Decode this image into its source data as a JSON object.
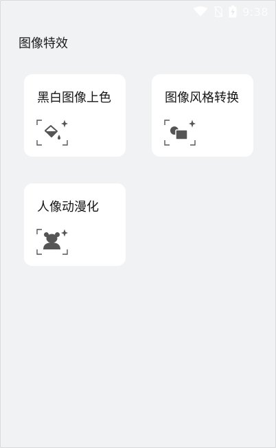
{
  "status_bar": {
    "time": "9:38",
    "icons": [
      "wifi-icon",
      "no-sim-icon",
      "battery-charging-icon"
    ]
  },
  "page": {
    "title": "图像特效"
  },
  "cards": [
    {
      "label": "黑白图像上色",
      "icon": "paint-bucket-sparkle-icon"
    },
    {
      "label": "图像风格转换",
      "icon": "style-transfer-sparkle-icon"
    },
    {
      "label": "人像动漫化",
      "icon": "bear-sparkle-icon"
    }
  ],
  "colors": {
    "background": "#f1f2f4",
    "card": "#ffffff",
    "icon": "#555555",
    "text": "#141414"
  }
}
